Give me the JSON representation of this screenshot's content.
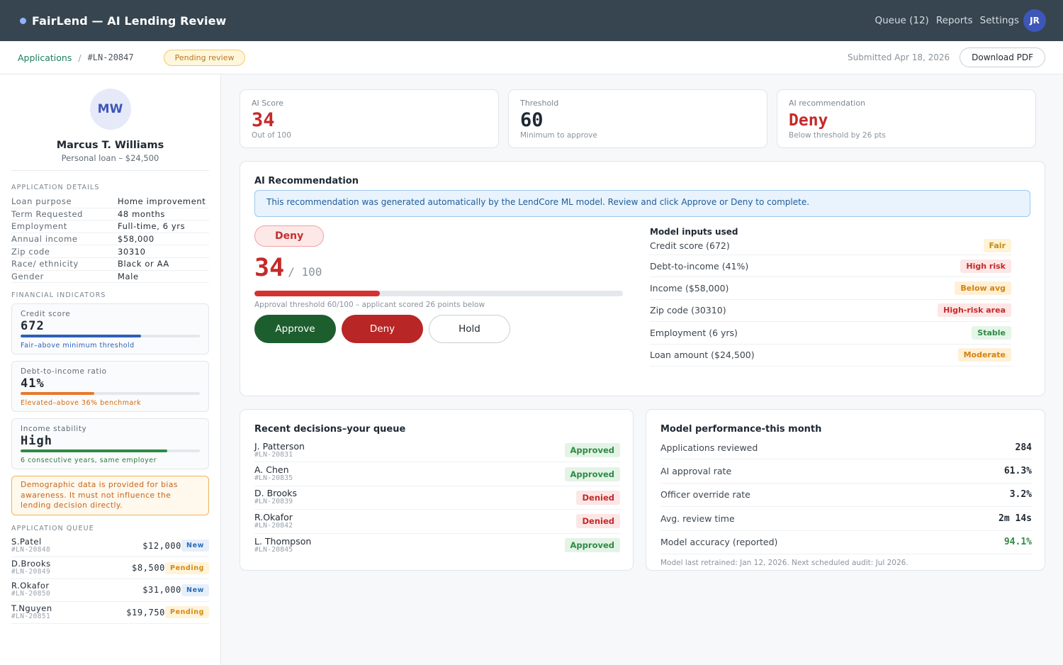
{
  "app": {
    "title": "FairLend — AI Lending Review"
  },
  "topnav": {
    "queue": "Queue (12)",
    "reports": "Reports",
    "settings": "Settings",
    "avatar": "JR"
  },
  "breadcrumb": {
    "applications": "Applications",
    "separator": "/",
    "app_id": "#LN-20847",
    "status": "Pending review",
    "submitted": "Submitted Apr 18, 2026",
    "download": "Download PDF"
  },
  "applicant": {
    "initials": "MW",
    "name": "Marcus T. Williams",
    "subtitle": "Personal loan – $24,500",
    "details_title": "APPLICATION DETAILS",
    "details": [
      {
        "label": "Loan purpose",
        "value": "Home improvement"
      },
      {
        "label": "Term Requested",
        "value": "48 months"
      },
      {
        "label": "Employment",
        "value": "Full-time, 6 yrs"
      },
      {
        "label": "Annual income",
        "value": "$58,000"
      },
      {
        "label": "Zip code",
        "value": "30310"
      },
      {
        "label": "Race/ ethnicity",
        "value": "Black or AA"
      },
      {
        "label": "Gender",
        "value": "Male"
      }
    ]
  },
  "indicators": {
    "title": "FINANCIAL INDICATORS",
    "items": [
      {
        "label": "Credit score",
        "value": "672",
        "note": "Fair–above minimum threshold",
        "level": 0.67,
        "color": "#2d5fb8",
        "note_color": "#2d5fb8"
      },
      {
        "label": "Debt-to-income ratio",
        "value": "41%",
        "note": "Elevated–above 36% benchmark",
        "level": 0.41,
        "color": "#e8772a",
        "note_color": "#d4680f"
      },
      {
        "label": "Income stability",
        "value": "High",
        "note": "6 consecutive years, same employer",
        "level": 0.82,
        "color": "#2f8a45",
        "note_color": "#2f7a3f"
      }
    ],
    "demographic_note": "Demographic data is provided for bias awareness. It must not influence the lending decision directly."
  },
  "queue": {
    "title": "APPLICATION QUEUE",
    "items": [
      {
        "name": "S.Patel",
        "id": "#LN-20848",
        "amount": "$12,000",
        "status": "New",
        "kind": "new"
      },
      {
        "name": "D.Brooks",
        "id": "#LN-20849",
        "amount": "$8,500",
        "status": "Pending",
        "kind": "pending"
      },
      {
        "name": "R.Okafor",
        "id": "#LN-20850",
        "amount": "$31,000",
        "status": "New",
        "kind": "new"
      },
      {
        "name": "T.Nguyen",
        "id": "#LN-20851",
        "amount": "$19,750",
        "status": "Pending",
        "kind": "pending"
      }
    ]
  },
  "stats": [
    {
      "label": "AI Score",
      "value": "34",
      "sub": "Out of 100",
      "color": "#c42a2a"
    },
    {
      "label": "Threshold",
      "value": "60",
      "sub": "Minimum to approve",
      "color": "#1f2933"
    },
    {
      "label": "AI recommendation",
      "value": "Deny",
      "sub": "Below threshold by 26 pts",
      "color": "#c42a2a"
    }
  ],
  "recommendation": {
    "title": "AI Recommendation",
    "info": "This recommendation was generated automatically by the LendCore ML model. Review and click Approve or Deny to complete.",
    "pill": "Deny",
    "score": "34",
    "score_den": "/ 100",
    "score_fraction": 0.34,
    "threshold_note": "Approval threshold 60/100 – applicant scored 26 points below",
    "buttons": {
      "approve": "Approve",
      "deny": "Deny",
      "hold": "Hold"
    },
    "inputs_title": "Model inputs used",
    "inputs": [
      {
        "label": "Credit score (672)",
        "tag": "Fair",
        "kind": "fair"
      },
      {
        "label": "Debt-to-income (41%)",
        "tag": "High risk",
        "kind": "risk"
      },
      {
        "label": "Income ($58,000)",
        "tag": "Below avg",
        "kind": "below"
      },
      {
        "label": "Zip code (30310)",
        "tag": "High-risk area",
        "kind": "risk"
      },
      {
        "label": "Employment (6 yrs)",
        "tag": "Stable",
        "kind": "stable"
      },
      {
        "label": "Loan amount ($24,500)",
        "tag": "Moderate",
        "kind": "moderate"
      }
    ]
  },
  "recent": {
    "title": "Recent decisions–your queue",
    "items": [
      {
        "name": "J. Patterson",
        "id": "#LN-20831",
        "status": "Approved",
        "kind": "ok"
      },
      {
        "name": "A. Chen",
        "id": "#LN-20835",
        "status": "Approved",
        "kind": "ok"
      },
      {
        "name": "D. Brooks",
        "id": "#LN-20839",
        "status": "Denied",
        "kind": "no"
      },
      {
        "name": "R.Okafor",
        "id": "#LN-20842",
        "status": "Denied",
        "kind": "no"
      },
      {
        "name": "L. Thompson",
        "id": "#LN-20845",
        "status": "Approved",
        "kind": "ok"
      }
    ]
  },
  "performance": {
    "title": "Model performance-this month",
    "items": [
      {
        "label": "Applications reviewed",
        "value": "284"
      },
      {
        "label": "AI approval rate",
        "value": "61.3%"
      },
      {
        "label": "Officer override rate",
        "value": "3.2%"
      },
      {
        "label": "Avg. review time",
        "value": "2m 14s"
      },
      {
        "label": "Model accuracy (reported)",
        "value": "94.1%",
        "color": "#2f8a45"
      }
    ],
    "note": "Model last retrained: Jan 12, 2026. Next scheduled audit: Jul 2026."
  }
}
